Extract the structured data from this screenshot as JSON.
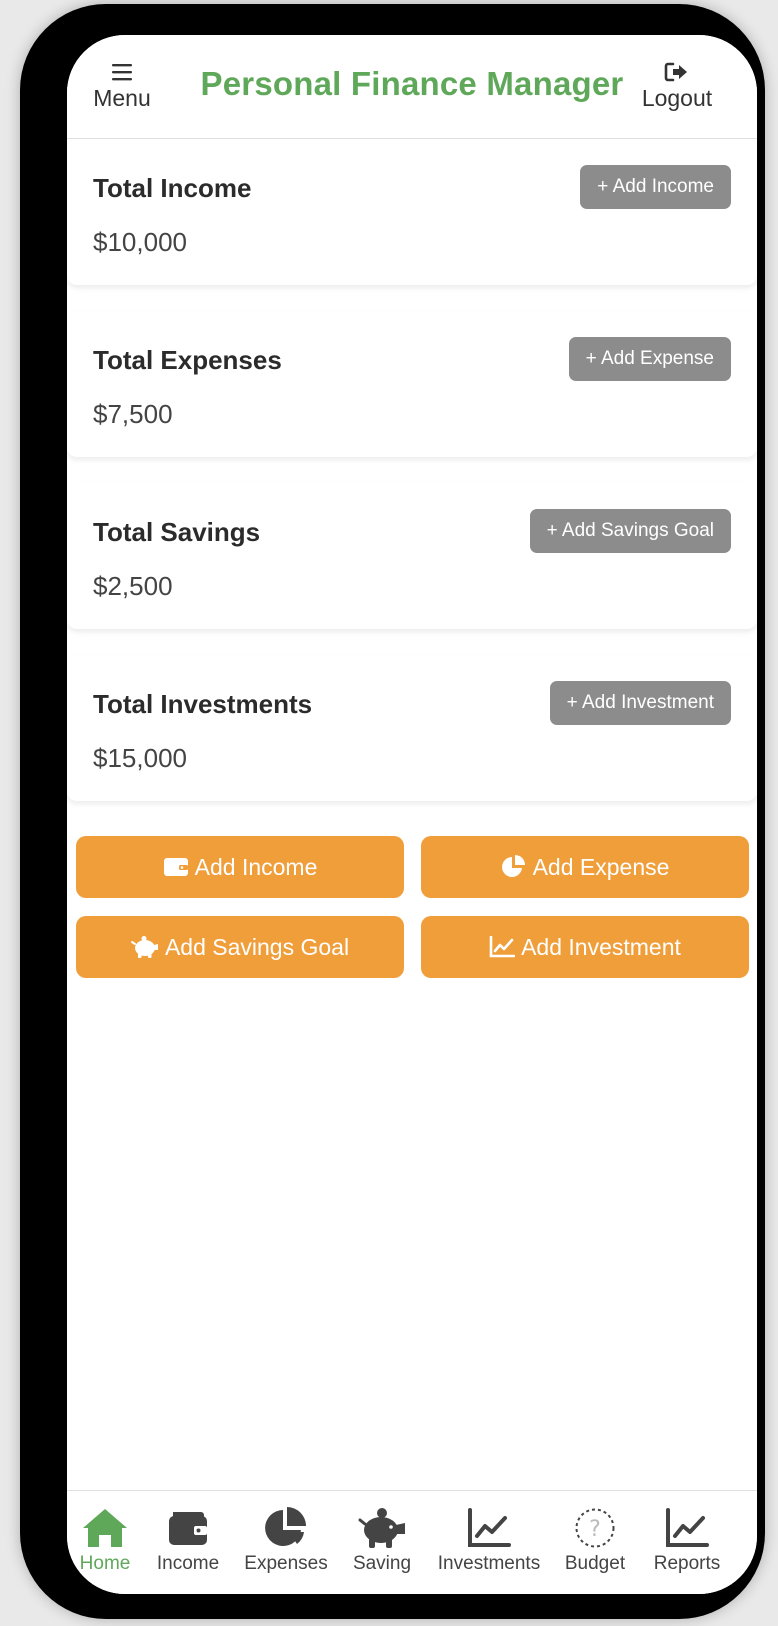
{
  "header": {
    "menu_label": "Menu",
    "title": "Personal Finance Manager",
    "logout_label": "Logout"
  },
  "cards": [
    {
      "title": "Total Income",
      "value": "$10,000",
      "button": "+ Add Income"
    },
    {
      "title": "Total Expenses",
      "value": "$7,500",
      "button": "+ Add Expense"
    },
    {
      "title": "Total Savings",
      "value": "$2,500",
      "button": "+ Add Savings Goal"
    },
    {
      "title": "Total Investments",
      "value": "$15,000",
      "button": "+ Add Investment"
    }
  ],
  "quick_actions": [
    {
      "label": "Add Income",
      "icon": "wallet-icon"
    },
    {
      "label": "Add Expense",
      "icon": "pie-chart-icon"
    },
    {
      "label": "Add Savings Goal",
      "icon": "piggy-bank-icon"
    },
    {
      "label": "Add Investment",
      "icon": "line-chart-icon"
    }
  ],
  "nav": {
    "items": [
      {
        "label": "Home",
        "icon": "home-icon",
        "active": true
      },
      {
        "label": "Income",
        "icon": "wallet-icon"
      },
      {
        "label": "Expenses",
        "icon": "pie-chart-icon"
      },
      {
        "label": "Saving",
        "icon": "piggy-bank-icon"
      },
      {
        "label": "Investments",
        "icon": "line-chart-icon"
      },
      {
        "label": "Budget",
        "icon": "question-icon"
      },
      {
        "label": "Reports",
        "icon": "line-chart-icon"
      }
    ]
  },
  "colors": {
    "brand_green": "#5fa85a",
    "accent_orange": "#f09e3a",
    "button_gray": "#8c8c8c",
    "frame": "#000000"
  }
}
